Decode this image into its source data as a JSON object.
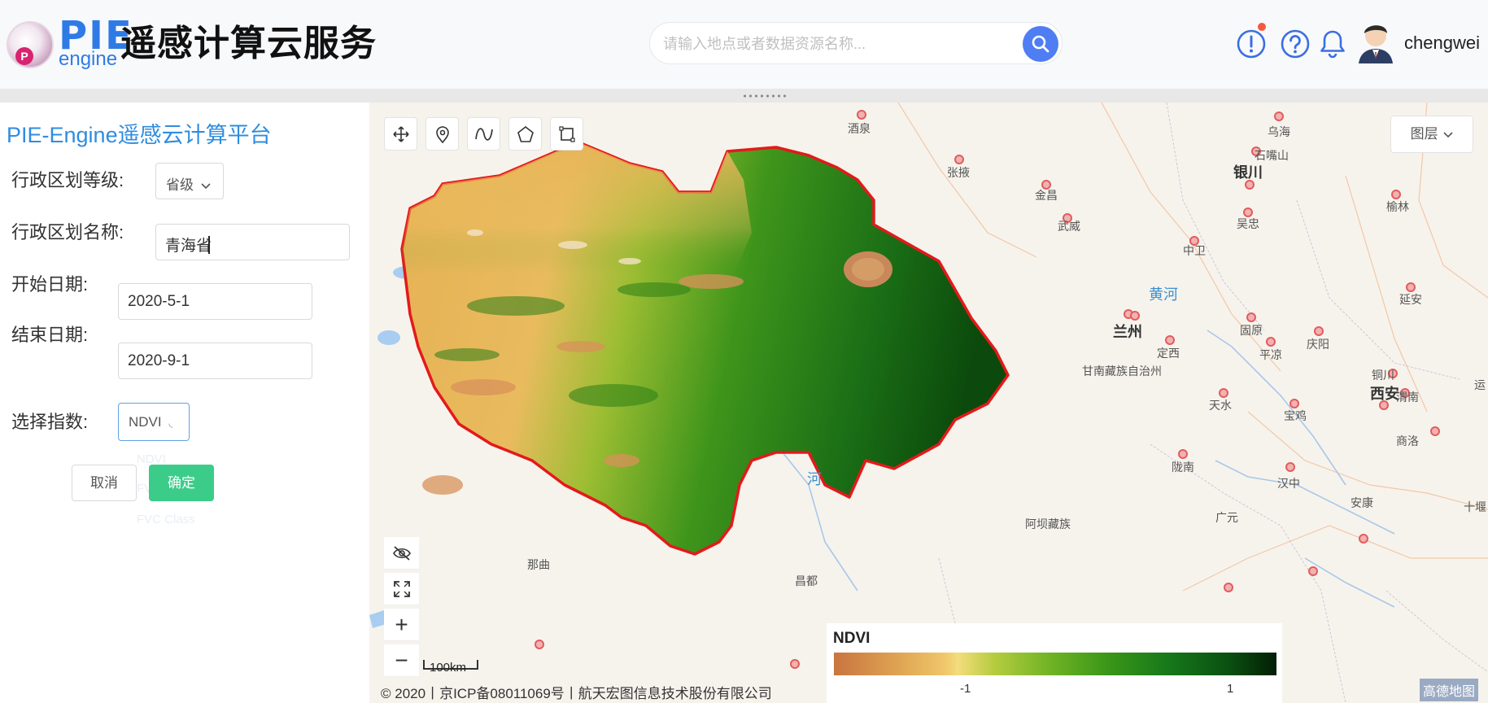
{
  "header": {
    "logo_mark": "P",
    "logo_pie": "PIE",
    "logo_engine": "engine",
    "title": "遥感计算云服务",
    "search_placeholder": "请输入地点或者数据资源名称...",
    "username": "chengwei",
    "icons": [
      "alert-circle-icon",
      "help-circle-icon",
      "bell-icon",
      "search-icon"
    ],
    "accent_color": "#4f7df3"
  },
  "panel": {
    "title": "PIE-Engine遥感云计算平台",
    "fields": {
      "admin_level_label": "行政区划等级:",
      "admin_level_value": "省级",
      "admin_name_label": "行政区划名称:",
      "admin_name_value": "青海省",
      "start_date_label": "开始日期:",
      "start_date_value": "2020-5-1",
      "end_date_label": "结束日期:",
      "end_date_value": "2020-9-1",
      "index_label": "选择指数:",
      "index_value": "NDVI"
    },
    "dropdown_ghost_options": [
      "NDVI",
      "FVC",
      "FVC Class"
    ],
    "cancel_label": "取消",
    "ok_label": "确定",
    "ok_color": "#3ccc8a"
  },
  "map": {
    "layer_button": "图层",
    "tools": [
      "move-icon",
      "marker-icon",
      "curve-icon",
      "polygon-icon",
      "rectangle-icon"
    ],
    "side_controls": [
      "eye-off-icon",
      "fullscreen-icon",
      "zoom-in-icon",
      "zoom-out-icon"
    ],
    "zoom_in_label": "+",
    "zoom_out_label": "−",
    "scale_label": "100km",
    "copyright": "© 2020丨京ICP备08011069号丨航天宏图信息技术股份有限公司",
    "map_logo": "高德地图",
    "legend": {
      "title": "NDVI",
      "min_label": "-1",
      "max_label": "1"
    },
    "labels": {
      "jiuquan": "酒泉",
      "zhangye": "张掖",
      "jinchang": "金昌",
      "wuwei": "武威",
      "wuhai": "乌海",
      "shizuishan": "石嘴山",
      "yinchuan": "银川",
      "wuzhong": "吴忠",
      "zhongwei": "中卫",
      "yulin": "榆林",
      "yanan": "延安",
      "lanzhou": "兰州",
      "dingxi": "定西",
      "guyuan": "固原",
      "pingliang": "平凉",
      "qingyang": "庆阳",
      "tongchuan": "铜川",
      "xian": "西安",
      "weinan": "渭南",
      "shangluo": "商洛",
      "tianshui": "天水",
      "baoji": "宝鸡",
      "longnan": "陇南",
      "hanzhong": "汉中",
      "ankang": "安康",
      "guangyuan": "广元",
      "aba": "阿坝藏族",
      "naqu": "那曲",
      "changdu": "昌都",
      "gannan": "甘南藏族自治州",
      "huanghe": "黄河",
      "he": "河",
      "shiyan": "十堰",
      "yuncheng": "运"
    }
  }
}
